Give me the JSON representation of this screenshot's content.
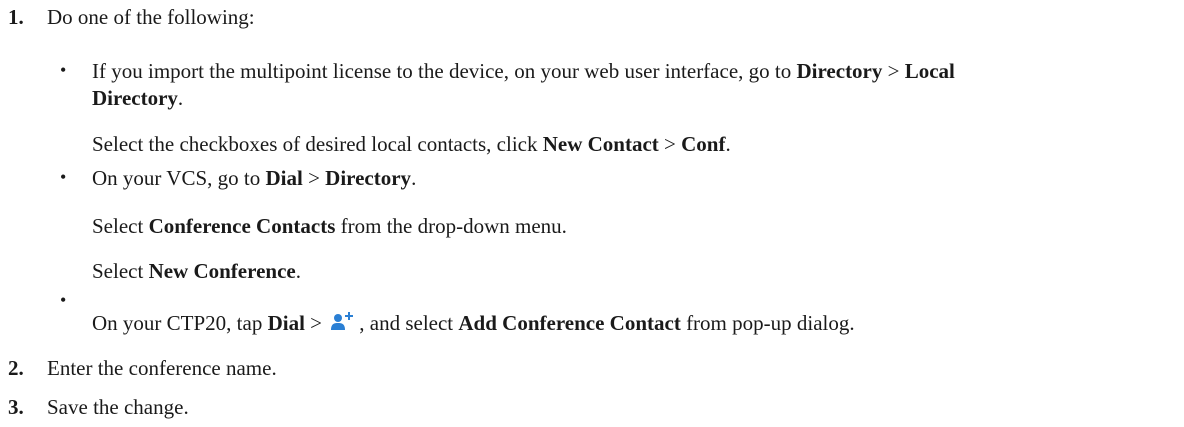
{
  "steps": [
    {
      "number": "1.",
      "text": "Do one of the following:"
    },
    {
      "number": "2.",
      "text": "Enter the conference name."
    },
    {
      "number": "3.",
      "text": "Save the change."
    }
  ],
  "bullet1": {
    "line1_pre": "If you import the multipoint license to the device, on your web user interface, go to ",
    "line1_b1": "Directory",
    "line1_sep": " > ",
    "line1_b2": "Local",
    "line2_b": "Directory",
    "line2_post": ".",
    "sub_pre": "Select the checkboxes of desired local contacts, click ",
    "sub_b1": "New Contact",
    "sub_sep": " > ",
    "sub_b2": "Conf",
    "sub_post": "."
  },
  "bullet2": {
    "pre": "On your VCS, go to ",
    "b1": "Dial",
    "sep": " > ",
    "b2": "Directory",
    "post": ".",
    "sub1_pre": "Select ",
    "sub1_b": "Conference Contacts",
    "sub1_post": " from the drop-down menu.",
    "sub2_pre": "Select ",
    "sub2_b": "New Conference",
    "sub2_post": "."
  },
  "bullet3": {
    "pre": "On your CTP20, tap ",
    "b1": "Dial",
    "sep": " > ",
    "icon": "add-contact-icon",
    "mid": ", and select ",
    "b2": "Add Conference Contact",
    "post": " from pop-up dialog."
  },
  "bullet_char": "•",
  "colors": {
    "text": "#1a1a1a",
    "icon": "#2a7fd4"
  }
}
